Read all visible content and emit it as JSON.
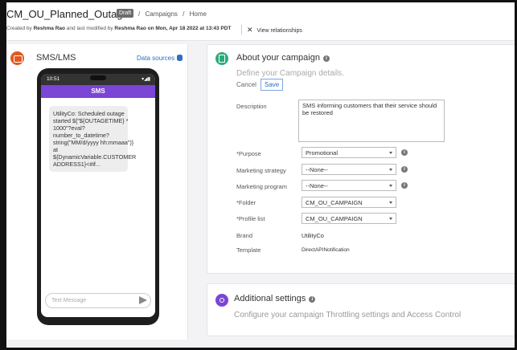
{
  "header": {
    "title": "CM_OU_Planned_Outag...",
    "badge": "Draft",
    "breadcrumbs": [
      "/",
      "Campaigns",
      "/",
      "Home"
    ],
    "meta_created_prefix": "Created by",
    "meta_created_by": "Reshma Rao",
    "meta_modified_prefix": "and last modified by",
    "meta_modified_by": "Reshma Rao on Mon, Apr 18 2022 at 13:43 PDT",
    "view_relationships": "View relationships"
  },
  "sms_panel": {
    "title": "SMS/LMS",
    "data_sources": "Data sources",
    "phone": {
      "time": "10:51",
      "signal": "▾◢▮",
      "header": "SMS",
      "message_lines": [
        "UtilityCo: Scheduled outage",
        "started ${\"${OUTAGETIME} *",
        "1000\"?eval?",
        "number_to_datetime?",
        "string(\"MM/d/yyyy hh:mmaaa\")}",
        "at",
        "${DynamicVariable.CUSTOMER",
        "ADDRESS1}<#if..."
      ],
      "input_placeholder": "Text Message"
    }
  },
  "campaign": {
    "title": "About your campaign",
    "define": "Define your Campaign details.",
    "cancel": "Cancel",
    "save": "Save",
    "description_label": "Description",
    "description_value": "SMS informing customers that their service should be restored",
    "purpose_label": "*Purpose",
    "purpose_value": "Promotional",
    "strategy_label": "Marketing strategy",
    "strategy_value": "--None--",
    "program_label": "Marketing program",
    "program_value": "--None--",
    "folder_label": "*Folder",
    "folder_value": "CM_OU_CAMPAIGN",
    "profile_label": "*Profile list",
    "profile_value": "CM_OU_CAMPAIGN",
    "brand_label": "Brand",
    "brand_value": "UtilityCo",
    "template_label": "Template",
    "template_value": "DirectAPINotification"
  },
  "additional": {
    "title": "Additional settings",
    "description": "Configure your campaign Throttling settings and Access Control"
  },
  "colors": {
    "sms_icon": "#e05a1f",
    "campaign_icon": "#2bab7a",
    "additional_icon": "#7b45d6",
    "link": "#2f6fbf"
  }
}
